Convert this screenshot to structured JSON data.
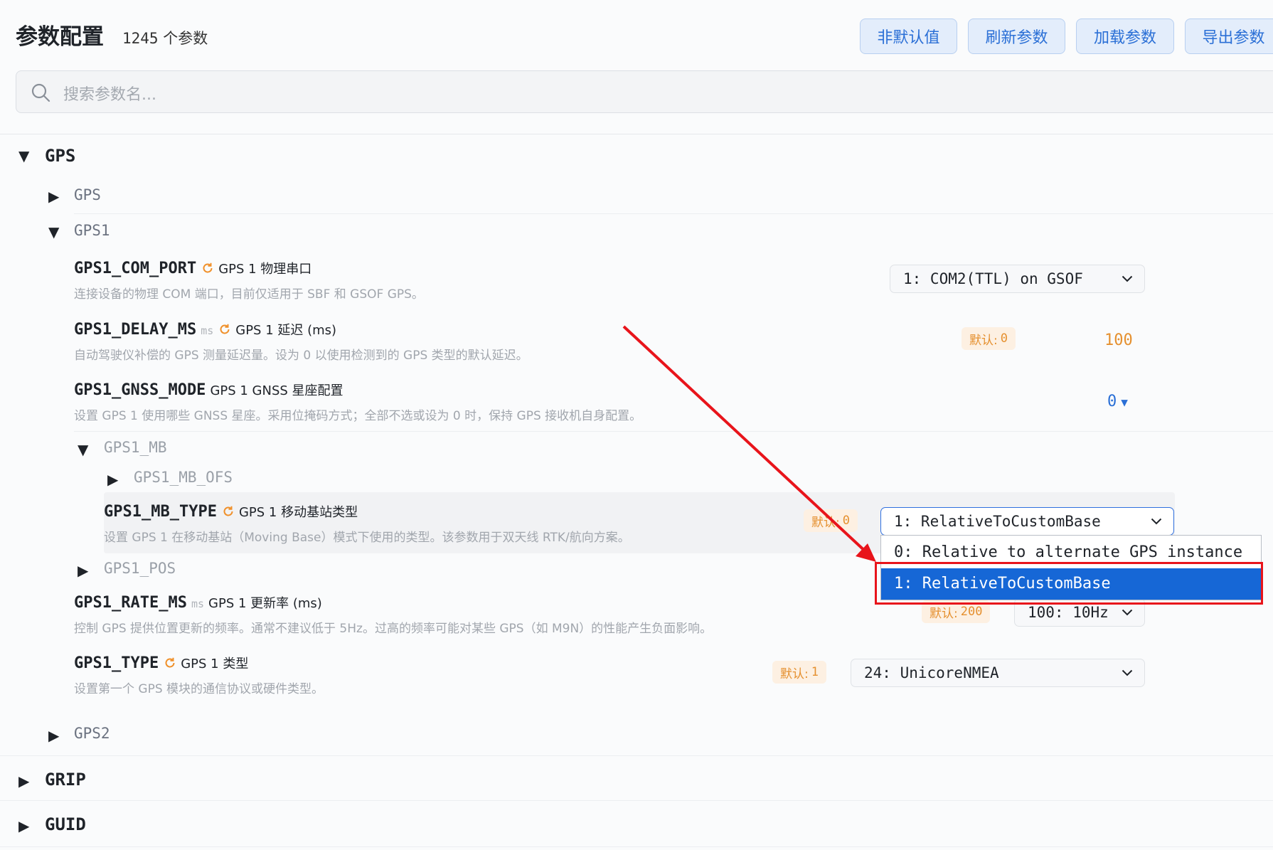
{
  "header": {
    "title": "参数配置",
    "count": "1245",
    "count_suffix": "个参数",
    "buttons": [
      "非默认值",
      "刷新参数",
      "加载参数",
      "导出参数"
    ]
  },
  "search": {
    "placeholder": "搜索参数名..."
  },
  "tree": {
    "gps_group": "GPS",
    "gps_sub": "GPS",
    "gps1_sub": "GPS1",
    "gps1_mb": "GPS1_MB",
    "gps1_mb_ofs": "GPS1_MB_OFS",
    "gps1_pos": "GPS1_POS",
    "gps2": "GPS2",
    "grip": "GRIP",
    "guid": "GUID"
  },
  "params": {
    "com_port": {
      "name": "GPS1_COM_PORT",
      "label": "GPS 1 物理串口",
      "desc": "连接设备的物理 COM 端口，目前仅适用于 SBF 和 GSOF GPS。",
      "value": "1: COM2(TTL) on GSOF"
    },
    "delay": {
      "name": "GPS1_DELAY_MS",
      "unit": "ms",
      "label": "GPS 1 延迟 (ms)",
      "desc": "自动驾驶仪补偿的 GPS 测量延迟量。设为 0 以使用检测到的 GPS 类型的默认延迟。",
      "default_label": "默认:",
      "default_value": "0",
      "value": "100"
    },
    "gnss_mode": {
      "name": "GPS1_GNSS_MODE",
      "label": "GPS 1 GNSS 星座配置",
      "desc": "设置 GPS 1 使用哪些 GNSS 星座。采用位掩码方式；全部不选或设为 0 时，保持 GPS 接收机自身配置。",
      "value": "0"
    },
    "mb_type": {
      "name": "GPS1_MB_TYPE",
      "label": "GPS 1 移动基站类型",
      "desc": "设置 GPS 1 在移动基站（Moving Base）模式下使用的类型。该参数用于双天线 RTK/航向方案。",
      "default_label": "默认:",
      "default_value": "0",
      "value": "1: RelativeToCustomBase",
      "options": [
        "0: Relative to alternate GPS instance",
        "1: RelativeToCustomBase"
      ]
    },
    "rate": {
      "name": "GPS1_RATE_MS",
      "unit": "ms",
      "label": "GPS 1 更新率 (ms)",
      "desc": "控制 GPS 提供位置更新的频率。通常不建议低于 5Hz。过高的频率可能对某些 GPS（如 M9N）的性能产生负面影响。",
      "default_label": "默认:",
      "default_value": "200",
      "value": "100: 10Hz"
    },
    "type": {
      "name": "GPS1_TYPE",
      "label": "GPS 1 类型",
      "desc": "设置第一个 GPS 模块的通信协议或硬件类型。",
      "default_label": "默认:",
      "default_value": "1",
      "value": "24: UnicoreNMEA"
    }
  },
  "colors": {
    "accent": "#2a6fd6",
    "default_badge": "#e5902f",
    "selected_option": "#1667d6",
    "annotation": "#e8141b"
  }
}
